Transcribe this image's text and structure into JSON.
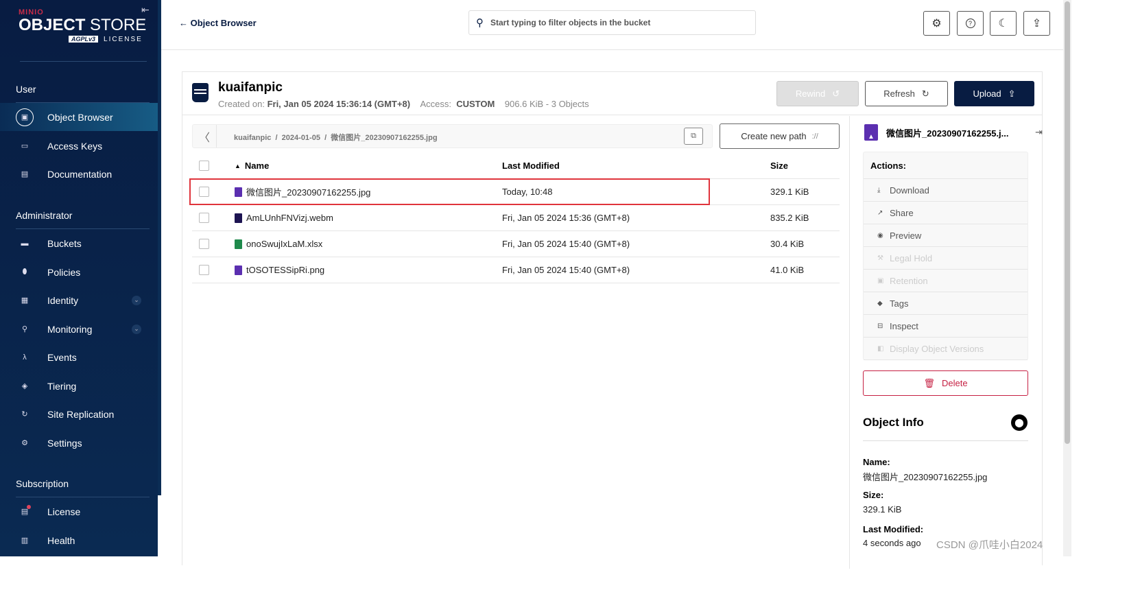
{
  "sidebar": {
    "logo": {
      "brand": "MINIO",
      "product_bold": "OBJECT",
      "product_light": "STORE",
      "license_badge": "AGPLv3",
      "license": "LICENSE"
    },
    "sections": [
      {
        "title": "User",
        "items": [
          {
            "label": "Object Browser",
            "icon": "object-browser-icon",
            "active": true
          },
          {
            "label": "Access Keys",
            "icon": "key-icon"
          },
          {
            "label": "Documentation",
            "icon": "document-icon"
          }
        ]
      },
      {
        "title": "Administrator",
        "items": [
          {
            "label": "Buckets",
            "icon": "bucket-icon"
          },
          {
            "label": "Policies",
            "icon": "shield-icon"
          },
          {
            "label": "Identity",
            "icon": "identity-icon",
            "expandable": true
          },
          {
            "label": "Monitoring",
            "icon": "monitoring-icon",
            "expandable": true
          },
          {
            "label": "Events",
            "icon": "lambda-icon"
          },
          {
            "label": "Tiering",
            "icon": "layers-icon"
          },
          {
            "label": "Site Replication",
            "icon": "sync-icon"
          },
          {
            "label": "Settings",
            "icon": "gear-icon"
          }
        ]
      },
      {
        "title": "Subscription",
        "items": [
          {
            "label": "License",
            "icon": "license-icon",
            "badge": true
          },
          {
            "label": "Health",
            "icon": "health-icon"
          }
        ]
      }
    ]
  },
  "header": {
    "back_label": "Object Browser",
    "search_placeholder": "Start typing to filter objects in the bucket",
    "buttons": [
      "gear-icon",
      "help-icon",
      "dark-mode-icon",
      "upload-icon"
    ]
  },
  "bucket": {
    "name": "kuaifanpic",
    "created_label": "Created on:",
    "created": "Fri, Jan 05 2024 15:36:14 (GMT+8)",
    "access_label": "Access:",
    "access": "CUSTOM",
    "summary": "906.6 KiB - 3 Objects",
    "rewind": "Rewind",
    "refresh": "Refresh",
    "upload": "Upload"
  },
  "breadcrumb": {
    "path": "kuaifanpic  /  2024-01-05  /  微信图片_20230907162255.jpg",
    "create_path": "Create new path"
  },
  "table": {
    "columns": {
      "name": "Name",
      "modified": "Last Modified",
      "size": "Size"
    },
    "rows": [
      {
        "name": "微信图片_20230907162255.jpg",
        "modified": "Today, 10:48",
        "size": "329.1 KiB",
        "type": "image",
        "selected": true
      },
      {
        "name": "AmLUnhFNVizj.webm",
        "modified": "Fri, Jan 05 2024 15:36 (GMT+8)",
        "size": "835.2 KiB",
        "type": "video"
      },
      {
        "name": "onoSwujIxLaM.xlsx",
        "modified": "Fri, Jan 05 2024 15:40 (GMT+8)",
        "size": "30.4 KiB",
        "type": "spreadsheet"
      },
      {
        "name": "tOSOTESSipRi.png",
        "modified": "Fri, Jan 05 2024 15:40 (GMT+8)",
        "size": "41.0 KiB",
        "type": "image"
      }
    ]
  },
  "details": {
    "title": "微信图片_20230907162255.j...",
    "actions_label": "Actions:",
    "actions": [
      {
        "label": "Download",
        "icon": "download-icon"
      },
      {
        "label": "Share",
        "icon": "share-icon"
      },
      {
        "label": "Preview",
        "icon": "eye-icon"
      },
      {
        "label": "Legal Hold",
        "icon": "gavel-icon",
        "disabled": true
      },
      {
        "label": "Retention",
        "icon": "calendar-icon",
        "disabled": true
      },
      {
        "label": "Tags",
        "icon": "tag-icon"
      },
      {
        "label": "Inspect",
        "icon": "inspect-icon"
      },
      {
        "label": "Display Object Versions",
        "icon": "versions-icon",
        "disabled": true
      }
    ],
    "delete": "Delete",
    "info_title": "Object Info",
    "name_label": "Name:",
    "name": "微信图片_20230907162255.jpg",
    "size_label": "Size:",
    "size": "329.1 KiB",
    "modified_label": "Last Modified:",
    "modified": "4 seconds ago"
  },
  "watermark": "CSDN @爪哇小白2024",
  "colors": {
    "sidebar": "#081c42",
    "primary": "#081c42",
    "danger": "#c51f42",
    "highlight": "#e0343c",
    "image_icon": "#5b2fb0",
    "sheet_icon": "#1f8a4c"
  }
}
